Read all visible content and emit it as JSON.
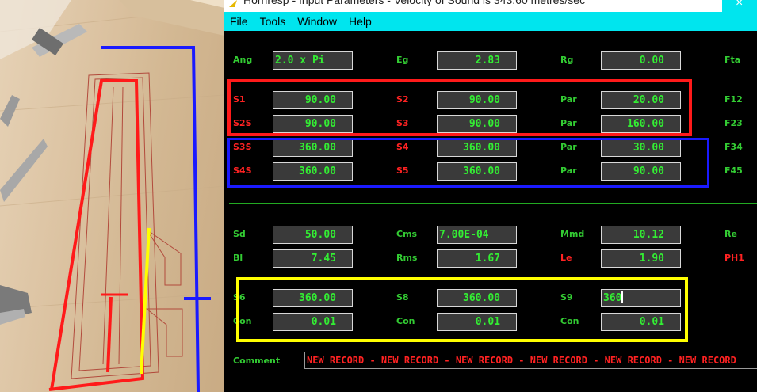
{
  "window": {
    "title": "Hornresp - Input Parameters - Velocity of Sound is 343.60 metres/sec",
    "close_glyph": "×"
  },
  "menu": [
    "File",
    "Tools",
    "Window",
    "Help"
  ],
  "rows": [
    {
      "cells": [
        {
          "label": "Ang",
          "value": "2.0 x Pi",
          "align": "left"
        },
        {
          "label": "Eg",
          "value": "2.83"
        },
        {
          "label": "Rg",
          "value": "0.00"
        },
        {
          "label": "Fta"
        }
      ]
    },
    {
      "cells": [
        {
          "label": "S1",
          "value": "90.00",
          "red": true
        },
        {
          "label": "S2",
          "value": "90.00",
          "red": true
        },
        {
          "label": "Par",
          "value": "20.00"
        },
        {
          "label": "F12"
        }
      ]
    },
    {
      "cells": [
        {
          "label": "S2S",
          "value": "90.00",
          "red": true
        },
        {
          "label": "S3",
          "value": "90.00",
          "red": true
        },
        {
          "label": "Par",
          "value": "160.00"
        },
        {
          "label": "F23"
        }
      ]
    },
    {
      "cells": [
        {
          "label": "S3S",
          "value": "360.00",
          "red": true
        },
        {
          "label": "S4",
          "value": "360.00",
          "red": true
        },
        {
          "label": "Par",
          "value": "30.00"
        },
        {
          "label": "F34"
        }
      ]
    },
    {
      "cells": [
        {
          "label": "S4S",
          "value": "360.00",
          "red": true
        },
        {
          "label": "S5",
          "value": "360.00",
          "red": true
        },
        {
          "label": "Par",
          "value": "90.00"
        },
        {
          "label": "F45"
        }
      ]
    },
    {
      "cells": [
        {
          "label": "Sd",
          "value": "50.00"
        },
        {
          "label": "Cms",
          "value": "7.00E-04",
          "align": "left"
        },
        {
          "label": "Mmd",
          "value": "10.12"
        },
        {
          "label": "Re"
        }
      ]
    },
    {
      "cells": [
        {
          "label": "Bl",
          "value": "7.45"
        },
        {
          "label": "Rms",
          "value": "1.67"
        },
        {
          "label": "Le",
          "value": "1.90",
          "red": true
        },
        {
          "label": "PH1",
          "red": true
        }
      ]
    },
    {
      "cells": [
        {
          "label": "S6",
          "value": "360.00"
        },
        {
          "label": "S8",
          "value": "360.00"
        },
        {
          "label": "S9",
          "value": "360",
          "align": "left",
          "editing": true
        },
        {}
      ]
    },
    {
      "cells": [
        {
          "label": "Con",
          "value": "0.01"
        },
        {
          "label": "Con",
          "value": "0.01"
        },
        {
          "label": "Con",
          "value": "0.01"
        },
        {}
      ]
    }
  ],
  "comment": {
    "label": "Comment",
    "value": "NEW RECORD - NEW RECORD - NEW RECORD - NEW RECORD - NEW RECORD - NEW RECORD"
  },
  "colors": {
    "label_green": "#33cc33",
    "value_green": "#33ee33",
    "label_red": "#ff2222",
    "menubar": "#00e5ee",
    "highlight_red": "#ff1a1a",
    "highlight_blue": "#1a1aff",
    "highlight_yellow": "#ffff00"
  }
}
